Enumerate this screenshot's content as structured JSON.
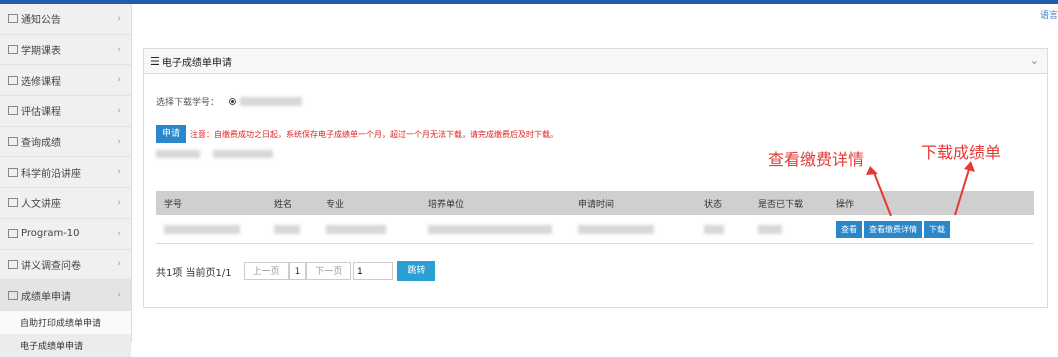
{
  "lang_link": "语言",
  "sidebar": {
    "items": [
      {
        "label": "通知公告"
      },
      {
        "label": "学期课表"
      },
      {
        "label": "选修课程"
      },
      {
        "label": "评估课程"
      },
      {
        "label": "查询成绩"
      },
      {
        "label": "科学前沿讲座"
      },
      {
        "label": "人文讲座"
      },
      {
        "label": "Program-10"
      },
      {
        "label": "讲义调查问卷"
      },
      {
        "label": "成绩单申请"
      }
    ],
    "sub_items": [
      {
        "label": "自助打印成绩单申请"
      },
      {
        "label": "电子成绩单申请"
      }
    ]
  },
  "panel": {
    "title": "电子成绩单申请",
    "select_label": "选择下载学号：",
    "apply_button": "申请",
    "notice": "注意：自缴费成功之日起，系统保存电子成绩单一个月，超过一个月无法下载，请完成缴费后及时下载。",
    "table": {
      "headers": [
        "学号",
        "姓名",
        "专业",
        "培养单位",
        "申请时间",
        "状态",
        "是否已下载",
        "操作"
      ],
      "actions": [
        "查看",
        "查看缴费详情",
        "下载"
      ]
    },
    "pager": {
      "summary": "共1项 当前页1/1",
      "prev": "上一页",
      "current": "1",
      "next": "下一页",
      "input_value": "1",
      "go": "跳转"
    }
  },
  "annotations": {
    "view_payment": "查看缴费详情",
    "download": "下载成绩单"
  },
  "colors": {
    "accent": "#2a87c9",
    "annotation": "#e53935",
    "notice": "#e02020"
  }
}
